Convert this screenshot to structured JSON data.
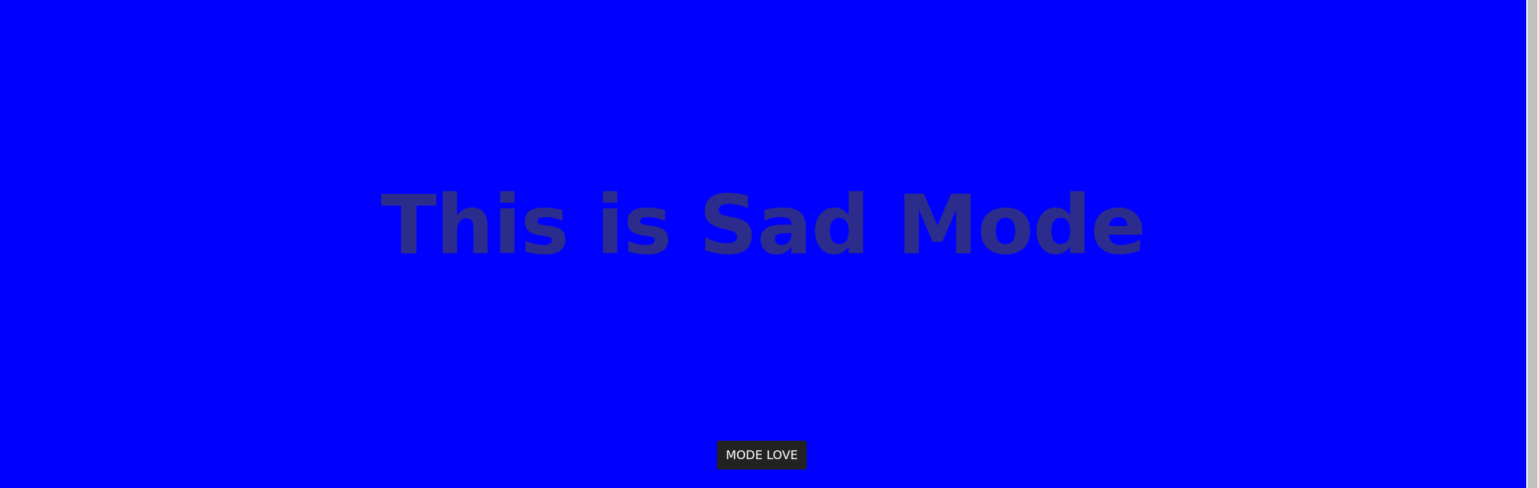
{
  "main": {
    "heading": "This is Sad Mode",
    "mode_button_label": "MODE LOVE"
  },
  "colors": {
    "background": "#0000ff",
    "heading_text": "#2c2c8c",
    "button_background": "#222222",
    "button_text": "#ffffff"
  }
}
